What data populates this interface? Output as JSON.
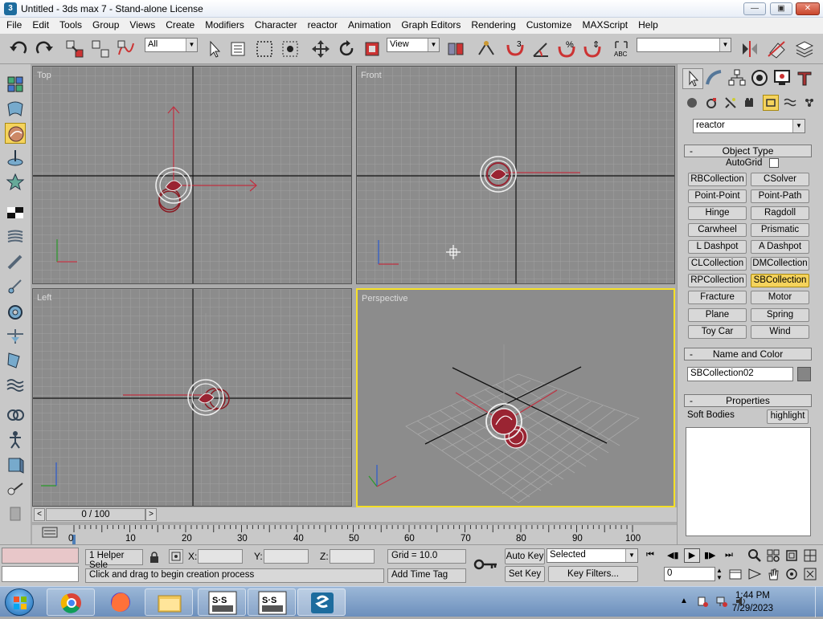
{
  "window": {
    "title": "Untitled - 3ds max 7 - Stand-alone License"
  },
  "menu": [
    "File",
    "Edit",
    "Tools",
    "Group",
    "Views",
    "Create",
    "Modifiers",
    "Character",
    "reactor",
    "Animation",
    "Graph Editors",
    "Rendering",
    "Customize",
    "MAXScript",
    "Help"
  ],
  "toolbar": {
    "filter_value": "All",
    "coord_value": "View",
    "selection_set": ""
  },
  "viewports": {
    "top": "Top",
    "front": "Front",
    "left": "Left",
    "perspective": "Perspective"
  },
  "command_panel": {
    "category_dropdown": "reactor",
    "object_type": {
      "title": "Object Type",
      "autogrid": "AutoGrid",
      "buttons": [
        "RBCollection",
        "CSolver",
        "Point-Point",
        "Point-Path",
        "Hinge",
        "Ragdoll",
        "Carwheel",
        "Prismatic",
        "L Dashpot",
        "A Dashpot",
        "CLCollection",
        "DMCollection",
        "RPCollection",
        "SBCollection",
        "Fracture",
        "Motor",
        "Plane",
        "Spring",
        "Toy Car",
        "Wind"
      ],
      "active": "SBCollection"
    },
    "name_and_color": {
      "title": "Name and Color",
      "name_value": "SBCollection02"
    },
    "properties": {
      "title": "Properties",
      "label": "Soft Bodies",
      "button": "highlight"
    }
  },
  "time_slider": {
    "label": "0 / 100"
  },
  "track": {
    "ticks": [
      "0",
      "10",
      "20",
      "30",
      "40",
      "50",
      "60",
      "70",
      "80",
      "90",
      "100"
    ]
  },
  "status": {
    "selection": "1 Helper Sele",
    "x_label": "X:",
    "y_label": "Y:",
    "z_label": "Z:",
    "grid": "Grid = 10.0",
    "prompt": "Click and drag to begin creation process",
    "add_time_tag": "Add Time Tag",
    "auto_key": "Auto Key",
    "set_key": "Set Key",
    "selected_value": "Selected",
    "key_filters": "Key Filters...",
    "frame_value": "0"
  },
  "taskbar": {
    "time": "1:44 PM",
    "date": "7/29/2023"
  },
  "colors": {
    "active_viewport": "#f5e027",
    "selected_button": "#f5d35c",
    "axis_red": "#b3283a"
  }
}
